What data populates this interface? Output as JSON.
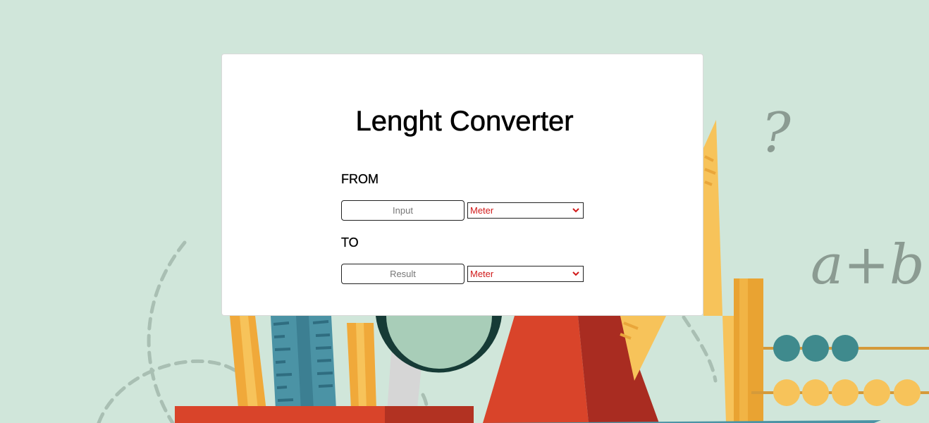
{
  "page": {
    "title": "Lenght Converter"
  },
  "from": {
    "label": "FROM",
    "input_placeholder": "Input",
    "unit_selected": "Meter"
  },
  "to": {
    "label": "TO",
    "result_placeholder": "Result",
    "unit_selected": "Meter"
  },
  "background": {
    "question_mark": "?",
    "formula": "a+b"
  },
  "colors": {
    "background": "#d0e6da",
    "select_text": "#d11a1a",
    "pencil_yellow": "#f5c04a",
    "tomato_red": "#d9442a",
    "teal": "#3f8a8d"
  }
}
